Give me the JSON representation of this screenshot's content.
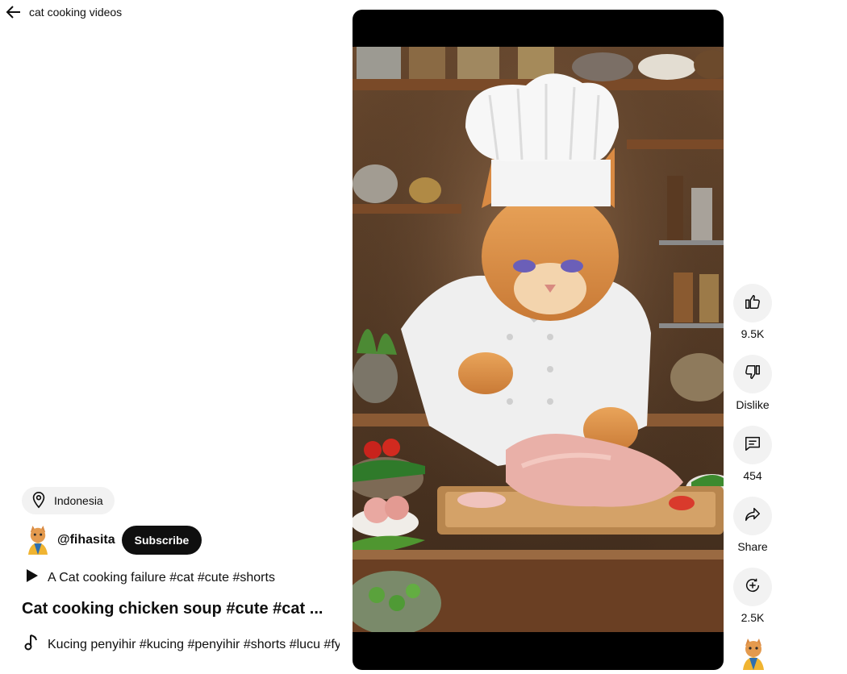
{
  "header": {
    "title": "cat cooking videos"
  },
  "meta": {
    "location": "Indonesia",
    "channel_handle": "@fihasita",
    "subscribe_label": "Subscribe",
    "related_video": "A Cat cooking failure #cat #cute #shorts",
    "title": "Cat cooking chicken soup #cute #cat ...",
    "music": "Kucing penyihir #kucing #penyihir #shorts #lucu #fyp"
  },
  "actions": {
    "like_count": "9.5K",
    "dislike_label": "Dislike",
    "comment_count": "454",
    "share_label": "Share",
    "remix_count": "2.5K"
  },
  "icons": {
    "back": "arrow-left-icon",
    "location": "location-pin-icon",
    "play": "play-icon",
    "music": "music-note-icon",
    "like": "thumbs-up-icon",
    "dislike": "thumbs-down-icon",
    "comment": "comment-icon",
    "share": "share-arrow-icon",
    "remix": "remix-icon"
  },
  "colors": {
    "accent": "#0f0f0f",
    "chip_bg": "#f2f2f2",
    "player_bg": "#000000"
  }
}
